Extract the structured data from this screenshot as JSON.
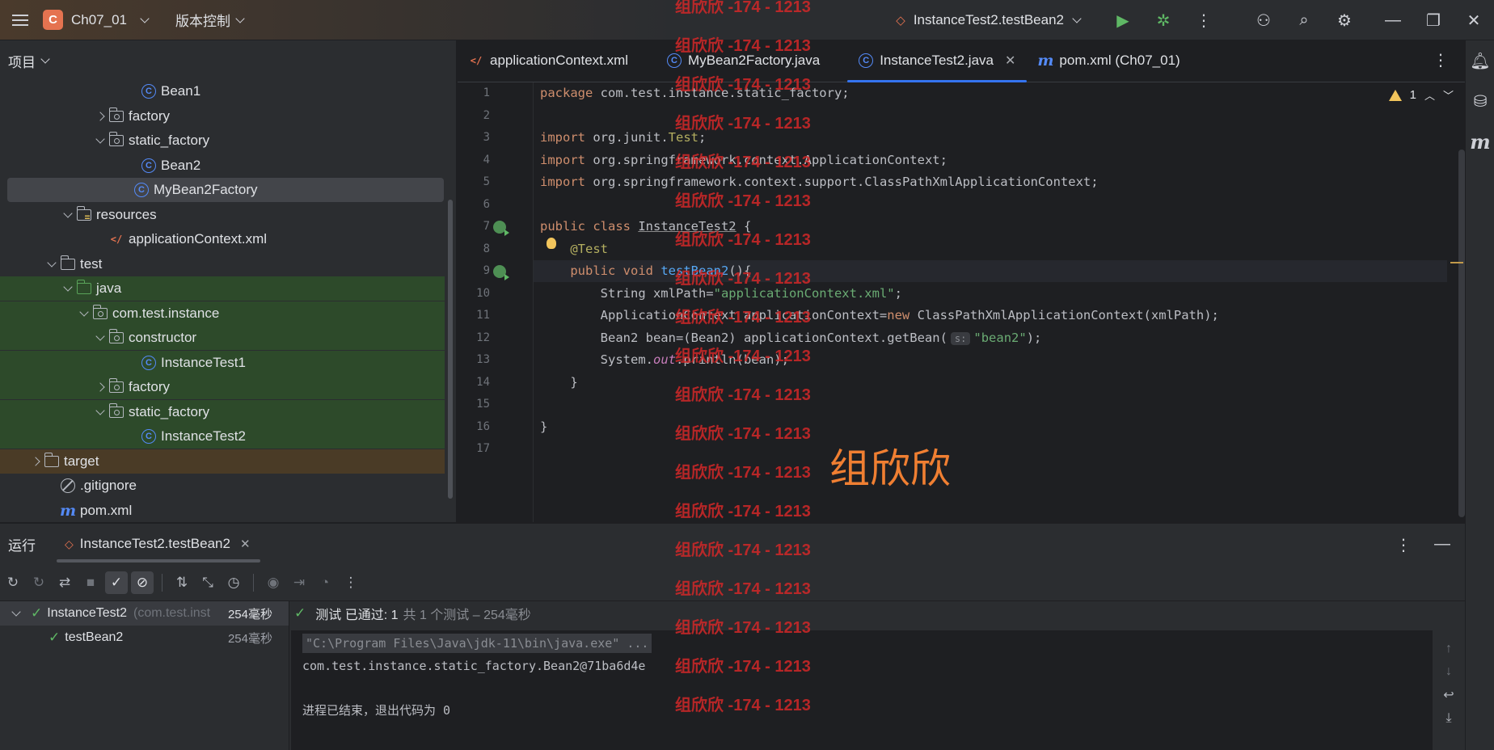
{
  "titlebar": {
    "project_badge": "C",
    "project_name": "Ch07_01",
    "vcs_label": "版本控制",
    "run_config": "InstanceTest2.testBean2"
  },
  "project_panel": {
    "title": "项目",
    "tree": [
      {
        "label": "Bean1",
        "icon": "class-icon",
        "depth": 7,
        "arrow": "none",
        "bg": ""
      },
      {
        "label": "factory",
        "icon": "package-icon",
        "depth": 5,
        "arrow": "right",
        "bg": ""
      },
      {
        "label": "static_factory",
        "icon": "package-icon",
        "depth": 5,
        "arrow": "down",
        "bg": ""
      },
      {
        "label": "Bean2",
        "icon": "class-icon",
        "depth": 7,
        "arrow": "none",
        "bg": ""
      },
      {
        "label": "MyBean2Factory",
        "icon": "class-icon",
        "depth": 7,
        "arrow": "none",
        "bg": "sel"
      },
      {
        "label": "resources",
        "icon": "resources-folder-icon",
        "depth": 3,
        "arrow": "down",
        "bg": ""
      },
      {
        "label": "applicationContext.xml",
        "icon": "xml-file-icon",
        "depth": 5,
        "arrow": "none",
        "bg": ""
      },
      {
        "label": "test",
        "icon": "folder-icon",
        "depth": 2,
        "arrow": "down",
        "bg": ""
      },
      {
        "label": "java",
        "icon": "test-source-folder-icon",
        "depth": 3,
        "arrow": "down",
        "bg": "green"
      },
      {
        "label": "com.test.instance",
        "icon": "package-icon",
        "depth": 4,
        "arrow": "down",
        "bg": "green"
      },
      {
        "label": "constructor",
        "icon": "package-icon",
        "depth": 5,
        "arrow": "down",
        "bg": "green"
      },
      {
        "label": "InstanceTest1",
        "icon": "class-icon",
        "depth": 7,
        "arrow": "none",
        "bg": "green"
      },
      {
        "label": "factory",
        "icon": "package-icon",
        "depth": 5,
        "arrow": "right",
        "bg": "green"
      },
      {
        "label": "static_factory",
        "icon": "package-icon",
        "depth": 5,
        "arrow": "down",
        "bg": "green"
      },
      {
        "label": "InstanceTest2",
        "icon": "class-icon",
        "depth": 7,
        "arrow": "none",
        "bg": "green"
      },
      {
        "label": "target",
        "icon": "folder-icon",
        "depth": 1,
        "arrow": "right",
        "bg": "orange"
      },
      {
        "label": ".gitignore",
        "icon": "gitignore-icon",
        "depth": 2,
        "arrow": "none",
        "bg": ""
      },
      {
        "label": "pom.xml",
        "icon": "maven-icon",
        "depth": 2,
        "arrow": "none",
        "bg": ""
      }
    ]
  },
  "editor": {
    "tabs": [
      {
        "label": "applicationContext.xml",
        "icon": "xml-file-icon",
        "active": false
      },
      {
        "label": "MyBean2Factory.java",
        "icon": "class-icon",
        "active": false
      },
      {
        "label": "InstanceTest2.java",
        "icon": "class-icon",
        "active": true,
        "closable": true
      },
      {
        "label": "pom.xml (Ch07_01)",
        "icon": "maven-icon",
        "active": false
      }
    ],
    "warning_count": "1",
    "line_numbers": [
      "1",
      "2",
      "3",
      "4",
      "5",
      "6",
      "7",
      "8",
      "9",
      "10",
      "11",
      "12",
      "13",
      "14",
      "15",
      "16",
      "17"
    ],
    "current_line": 9,
    "code_lines": [
      [
        [
          "kw",
          "package"
        ],
        [
          "",
          "com.test.instance.static_factory;"
        ]
      ],
      [],
      [
        [
          "kw",
          "import"
        ],
        [
          "",
          "org.junit."
        ],
        [
          "ann",
          "Test"
        ],
        [
          "",
          ";"
        ]
      ],
      [
        [
          "kw",
          "import"
        ],
        [
          "",
          "org.springframework.context.ApplicationContext;"
        ]
      ],
      [
        [
          "kw",
          "import"
        ],
        [
          "",
          "org.springframework.context.support.ClassPathXmlApplicationContext;"
        ]
      ],
      [],
      [
        [
          "kw",
          "public class"
        ],
        [
          "cls-u",
          "InstanceTest2"
        ],
        [
          "",
          " {"
        ]
      ],
      [
        [
          "",
          "    "
        ],
        [
          "ann",
          "@Test"
        ]
      ],
      [
        [
          "",
          "    "
        ],
        [
          "kw",
          "public void"
        ],
        [
          "fn-def",
          "testBean2"
        ],
        [
          "",
          "(){"
        ]
      ],
      [
        [
          "",
          "        String xmlPath="
        ],
        [
          "str",
          "\"applicationContext.xml\""
        ],
        [
          "",
          ";"
        ]
      ],
      [
        [
          "",
          "        ApplicationContext applicationContext="
        ],
        [
          "kw",
          "new"
        ],
        [
          "",
          " ClassPathXmlApplicationContext(xmlPath);"
        ]
      ],
      [
        [
          "",
          "        Bean2 bean=(Bean2) applicationContext.getBean("
        ],
        [
          "hint",
          "s:"
        ],
        [
          "str",
          "\"bean2\""
        ],
        [
          "",
          ");"
        ]
      ],
      [
        [
          "",
          "        System."
        ],
        [
          "fld",
          "out"
        ],
        [
          "",
          ".println(bean);"
        ]
      ],
      [
        [
          "",
          "    }"
        ]
      ],
      [],
      [
        [
          "",
          "}"
        ]
      ],
      []
    ]
  },
  "run_panel": {
    "title": "运行",
    "tab_label": "InstanceTest2.testBean2",
    "test_tree": [
      {
        "name": "InstanceTest2",
        "detail": "(com.test.inst",
        "time": "254毫秒",
        "selected": true
      },
      {
        "name": "testBean2",
        "detail": "",
        "time": "254毫秒",
        "selected": false
      }
    ],
    "status_prefix": "测试 已通过: 1",
    "status_suffix": "共 1 个测试 – 254毫秒",
    "console_lines": [
      "\"C:\\Program Files\\Java\\jdk-11\\bin\\java.exe\" ...",
      "com.test.instance.static_factory.Bean2@71ba6d4e",
      "",
      "进程已结束，退出代码为 0"
    ]
  },
  "watermark": {
    "repeated_text": "组欣欣 -174 - 1213",
    "big_text": "组欣欣"
  }
}
